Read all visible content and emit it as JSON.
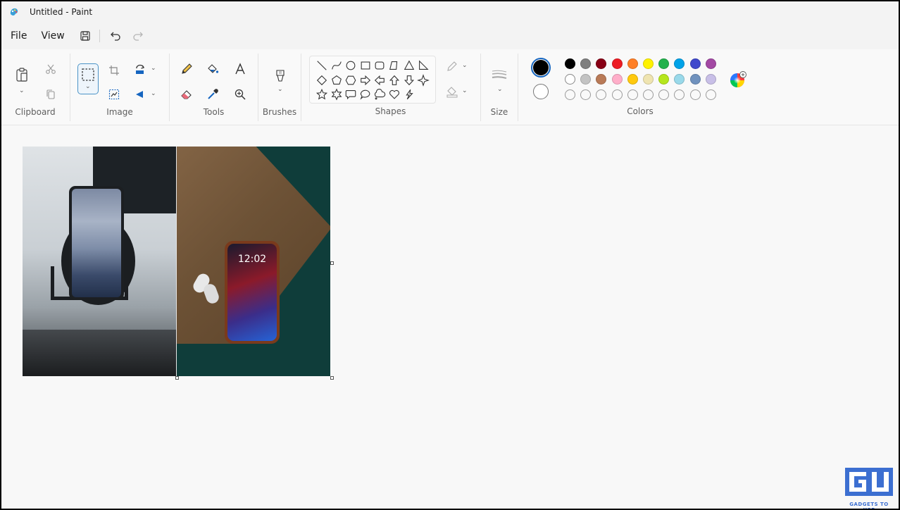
{
  "window": {
    "title": "Untitled - Paint"
  },
  "menu": {
    "file": "File",
    "view": "View"
  },
  "toolbar_icons": [
    "save-icon",
    "undo-icon",
    "redo-icon"
  ],
  "groups": {
    "clipboard": "Clipboard",
    "image": "Image",
    "tools": "Tools",
    "brushes": "Brushes",
    "shapes": "Shapes",
    "size": "Size",
    "colors": "Colors"
  },
  "colors": {
    "primary": "#000000",
    "secondary": "#ffffff",
    "palette_row1": [
      "#000000",
      "#7f7f7f",
      "#880015",
      "#ed1c24",
      "#ff7f27",
      "#fff200",
      "#22b14c",
      "#00a2e8",
      "#3f48cc",
      "#a349a4"
    ],
    "palette_row2": [
      "#ffffff",
      "#c3c3c3",
      "#b97a57",
      "#ffaec9",
      "#ffc90e",
      "#efe4b0",
      "#b5e61d",
      "#99d9ea",
      "#7092be",
      "#c8bfe7"
    ]
  },
  "phone": {
    "time": "12:02"
  },
  "watermark": {
    "brand": "GADGETS TO USE",
    "mark": "GU"
  }
}
